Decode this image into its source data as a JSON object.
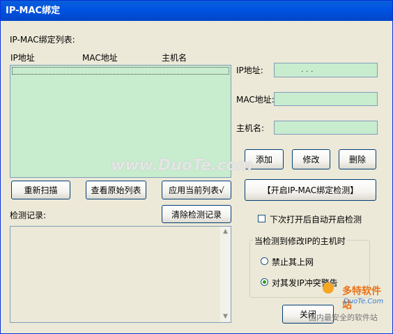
{
  "window": {
    "title": "IP-MAC绑定"
  },
  "binding_list": {
    "label": "IP-MAC绑定列表:",
    "columns": [
      "IP地址",
      "MAC地址",
      "主机名"
    ]
  },
  "fields": {
    "ip_label": "IP地址:",
    "ip_dots": ".       .       .",
    "mac_label": "MAC地址:",
    "host_label": "主机名:"
  },
  "buttons": {
    "add": "添加",
    "modify": "修改",
    "delete": "删除",
    "rescan": "重新扫描",
    "view_original": "查看原始列表",
    "apply_current": "应用当前列表√",
    "start_detection": "【开启IP-MAC绑定检测】",
    "clear_log": "清除检测记录",
    "close": "关闭"
  },
  "log": {
    "label": "检测记录:"
  },
  "options": {
    "auto_start_label": "下次打开后自动开启检测",
    "auto_start_checked": false,
    "group_title": "当检测到修改IP的主机时",
    "radio_block": "禁止其上网",
    "radio_warn": "对其发IP冲突警告",
    "selected": "warn"
  },
  "watermark": {
    "center": "www.DuoTe.com",
    "badge": "多特软件站",
    "badge_url": "DuoTe.Com",
    "slogan": "国内最安全的软件站"
  }
}
